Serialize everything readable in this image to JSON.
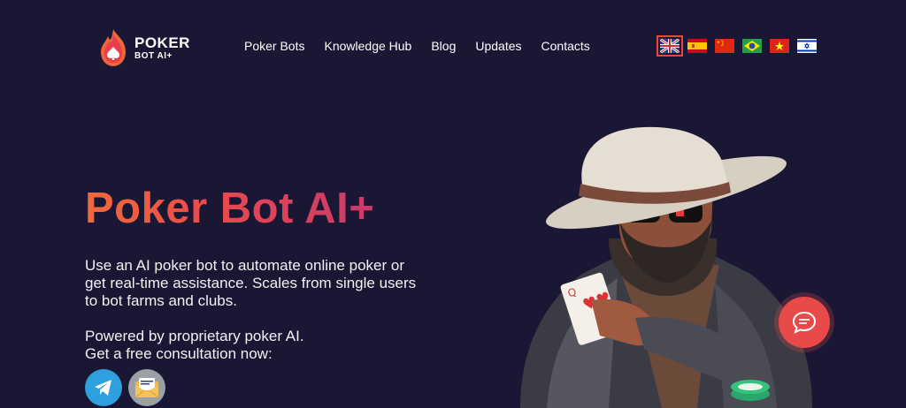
{
  "brand": {
    "name": "POKER",
    "sub": "BOT AI+"
  },
  "nav": {
    "items": [
      {
        "label": "Poker Bots"
      },
      {
        "label": "Knowledge Hub"
      },
      {
        "label": "Blog"
      },
      {
        "label": "Updates"
      },
      {
        "label": "Contacts"
      }
    ]
  },
  "languages": [
    {
      "code": "en",
      "icon": "uk-flag-icon",
      "active": true
    },
    {
      "code": "es",
      "icon": "spain-flag-icon",
      "active": false
    },
    {
      "code": "zh",
      "icon": "china-flag-icon",
      "active": false
    },
    {
      "code": "pt",
      "icon": "brazil-flag-icon",
      "active": false
    },
    {
      "code": "vi",
      "icon": "vietnam-flag-icon",
      "active": false
    },
    {
      "code": "he",
      "icon": "israel-flag-icon",
      "active": false
    }
  ],
  "hero": {
    "title": "Poker Bot AI+",
    "description": "Use an AI poker bot to automate online poker or get real-time assistance. Scales from single users to bot farms and clubs.",
    "powered_line1": "Powered by proprietary poker AI.",
    "powered_line2": "Get a free consultation now:"
  },
  "contacts": [
    {
      "icon": "telegram-icon"
    },
    {
      "icon": "email-icon"
    }
  ],
  "colors": {
    "background": "#191734",
    "accent_start": "#f06a3a",
    "accent_end": "#c9396a",
    "chat_button": "#e84a4a"
  }
}
